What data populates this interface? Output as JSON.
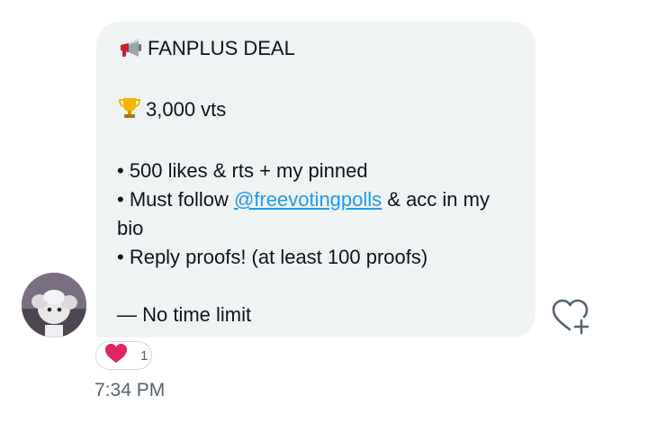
{
  "message": {
    "title_emoji": "loudspeaker-icon",
    "title": "FANPLUS DEAL",
    "prize_emoji": "trophy-icon",
    "prize": "3,000 vts",
    "bullet1": "• 500 likes & rts + my pinned",
    "bullet2_prefix": "• Must follow ",
    "bullet2_link": "@freevotingpolls",
    "bullet2_suffix": " & acc in my bio",
    "bullet3": "• Reply proofs! (at least 100 proofs)",
    "footer": "— No time limit"
  },
  "reaction": {
    "emoji": "heart-icon",
    "count": "1",
    "color": "#e0245e"
  },
  "timestamp": "7:34 PM",
  "colors": {
    "bubble": "#eff3f4",
    "link": "#1d9bf0",
    "muted": "#536471"
  }
}
